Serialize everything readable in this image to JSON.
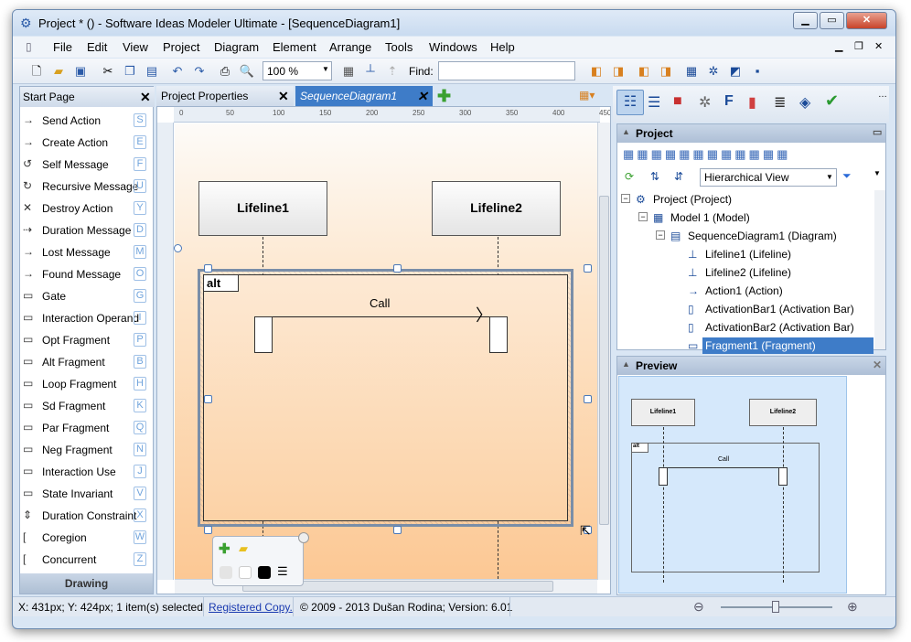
{
  "window": {
    "title": "Project * () - Software Ideas Modeler Ultimate - [SequenceDiagram1]",
    "controls": {
      "minimize": "▁",
      "maximize": "▭",
      "close": "✕"
    }
  },
  "menubar": {
    "items": [
      "File",
      "Edit",
      "View",
      "Project",
      "Diagram",
      "Element",
      "Arrange",
      "Tools",
      "Windows",
      "Help"
    ],
    "right": [
      "▁",
      "❐",
      "✕"
    ]
  },
  "toolbar": {
    "zoom": "100 %",
    "find_label": "Find:",
    "find_value": ""
  },
  "left_panel": {
    "tab": "Start Page",
    "tools": [
      {
        "label": "Send Action",
        "key": "S",
        "icon": "→"
      },
      {
        "label": "Create Action",
        "key": "E",
        "icon": "→"
      },
      {
        "label": "Self Message",
        "key": "F",
        "icon": "↺"
      },
      {
        "label": "Recursive Message",
        "key": "U",
        "icon": "↻"
      },
      {
        "label": "Destroy Action",
        "key": "Y",
        "icon": "✕"
      },
      {
        "label": "Duration Message",
        "key": "D",
        "icon": "⇢"
      },
      {
        "label": "Lost Message",
        "key": "M",
        "icon": "→"
      },
      {
        "label": "Found Message",
        "key": "O",
        "icon": "→"
      },
      {
        "label": "Gate",
        "key": "G",
        "icon": "▭"
      },
      {
        "label": "Interaction Operand",
        "key": "I",
        "icon": "▭"
      },
      {
        "label": "Opt Fragment",
        "key": "P",
        "icon": "▭"
      },
      {
        "label": "Alt Fragment",
        "key": "B",
        "icon": "▭"
      },
      {
        "label": "Loop Fragment",
        "key": "H",
        "icon": "▭"
      },
      {
        "label": "Sd Fragment",
        "key": "K",
        "icon": "▭"
      },
      {
        "label": "Par Fragment",
        "key": "Q",
        "icon": "▭"
      },
      {
        "label": "Neg Fragment",
        "key": "N",
        "icon": "▭"
      },
      {
        "label": "Interaction Use",
        "key": "J",
        "icon": "▭"
      },
      {
        "label": "State Invariant",
        "key": "V",
        "icon": "▭"
      },
      {
        "label": "Duration Constraint",
        "key": "X",
        "icon": "⇕"
      },
      {
        "label": "Coregion",
        "key": "W",
        "icon": "["
      },
      {
        "label": "Concurrent",
        "key": "Z",
        "icon": "["
      }
    ],
    "footer": "Drawing"
  },
  "doc_tabs": [
    {
      "label": "Project Properties"
    },
    {
      "label": "SequenceDiagram1"
    }
  ],
  "ruler": {
    "top": [
      "0",
      "50",
      "100",
      "150",
      "200",
      "250",
      "300",
      "350",
      "400",
      "450"
    ]
  },
  "diagram": {
    "lifelines": [
      "Lifeline1",
      "Lifeline2"
    ],
    "fragment_label": "alt",
    "message": "Call"
  },
  "project_panel": {
    "title": "Project",
    "view": "Hierarchical View",
    "tree": [
      {
        "label": "Project (Project)",
        "toggle": "−",
        "icon": "⚙"
      },
      {
        "label": "Model 1 (Model)",
        "toggle": "−",
        "icon": "▦"
      },
      {
        "label": "SequenceDiagram1 (Diagram)",
        "toggle": "−",
        "icon": "▤"
      },
      {
        "label": "Lifeline1 (Lifeline)",
        "toggle": "",
        "icon": "⊥"
      },
      {
        "label": "Lifeline2 (Lifeline)",
        "toggle": "",
        "icon": "⊥"
      },
      {
        "label": "Action1 (Action)",
        "toggle": "",
        "icon": "→"
      },
      {
        "label": "ActivationBar1 (Activation Bar)",
        "toggle": "",
        "icon": "▯"
      },
      {
        "label": "ActivationBar2 (Activation Bar)",
        "toggle": "",
        "icon": "▯"
      },
      {
        "label": "Fragment1 (Fragment)",
        "toggle": "",
        "icon": "▭"
      }
    ]
  },
  "preview": {
    "title": "Preview",
    "lifelines": [
      "Lifeline1",
      "Lifeline2"
    ],
    "fragment_label": "alt",
    "message": "Call"
  },
  "statusbar": {
    "coords": "X: 431px; Y: 424px; 1 item(s) selected",
    "registered": "Registered Copy.",
    "copyright": "© 2009 - 2013 Dušan Rodina; Version: 6.01"
  }
}
